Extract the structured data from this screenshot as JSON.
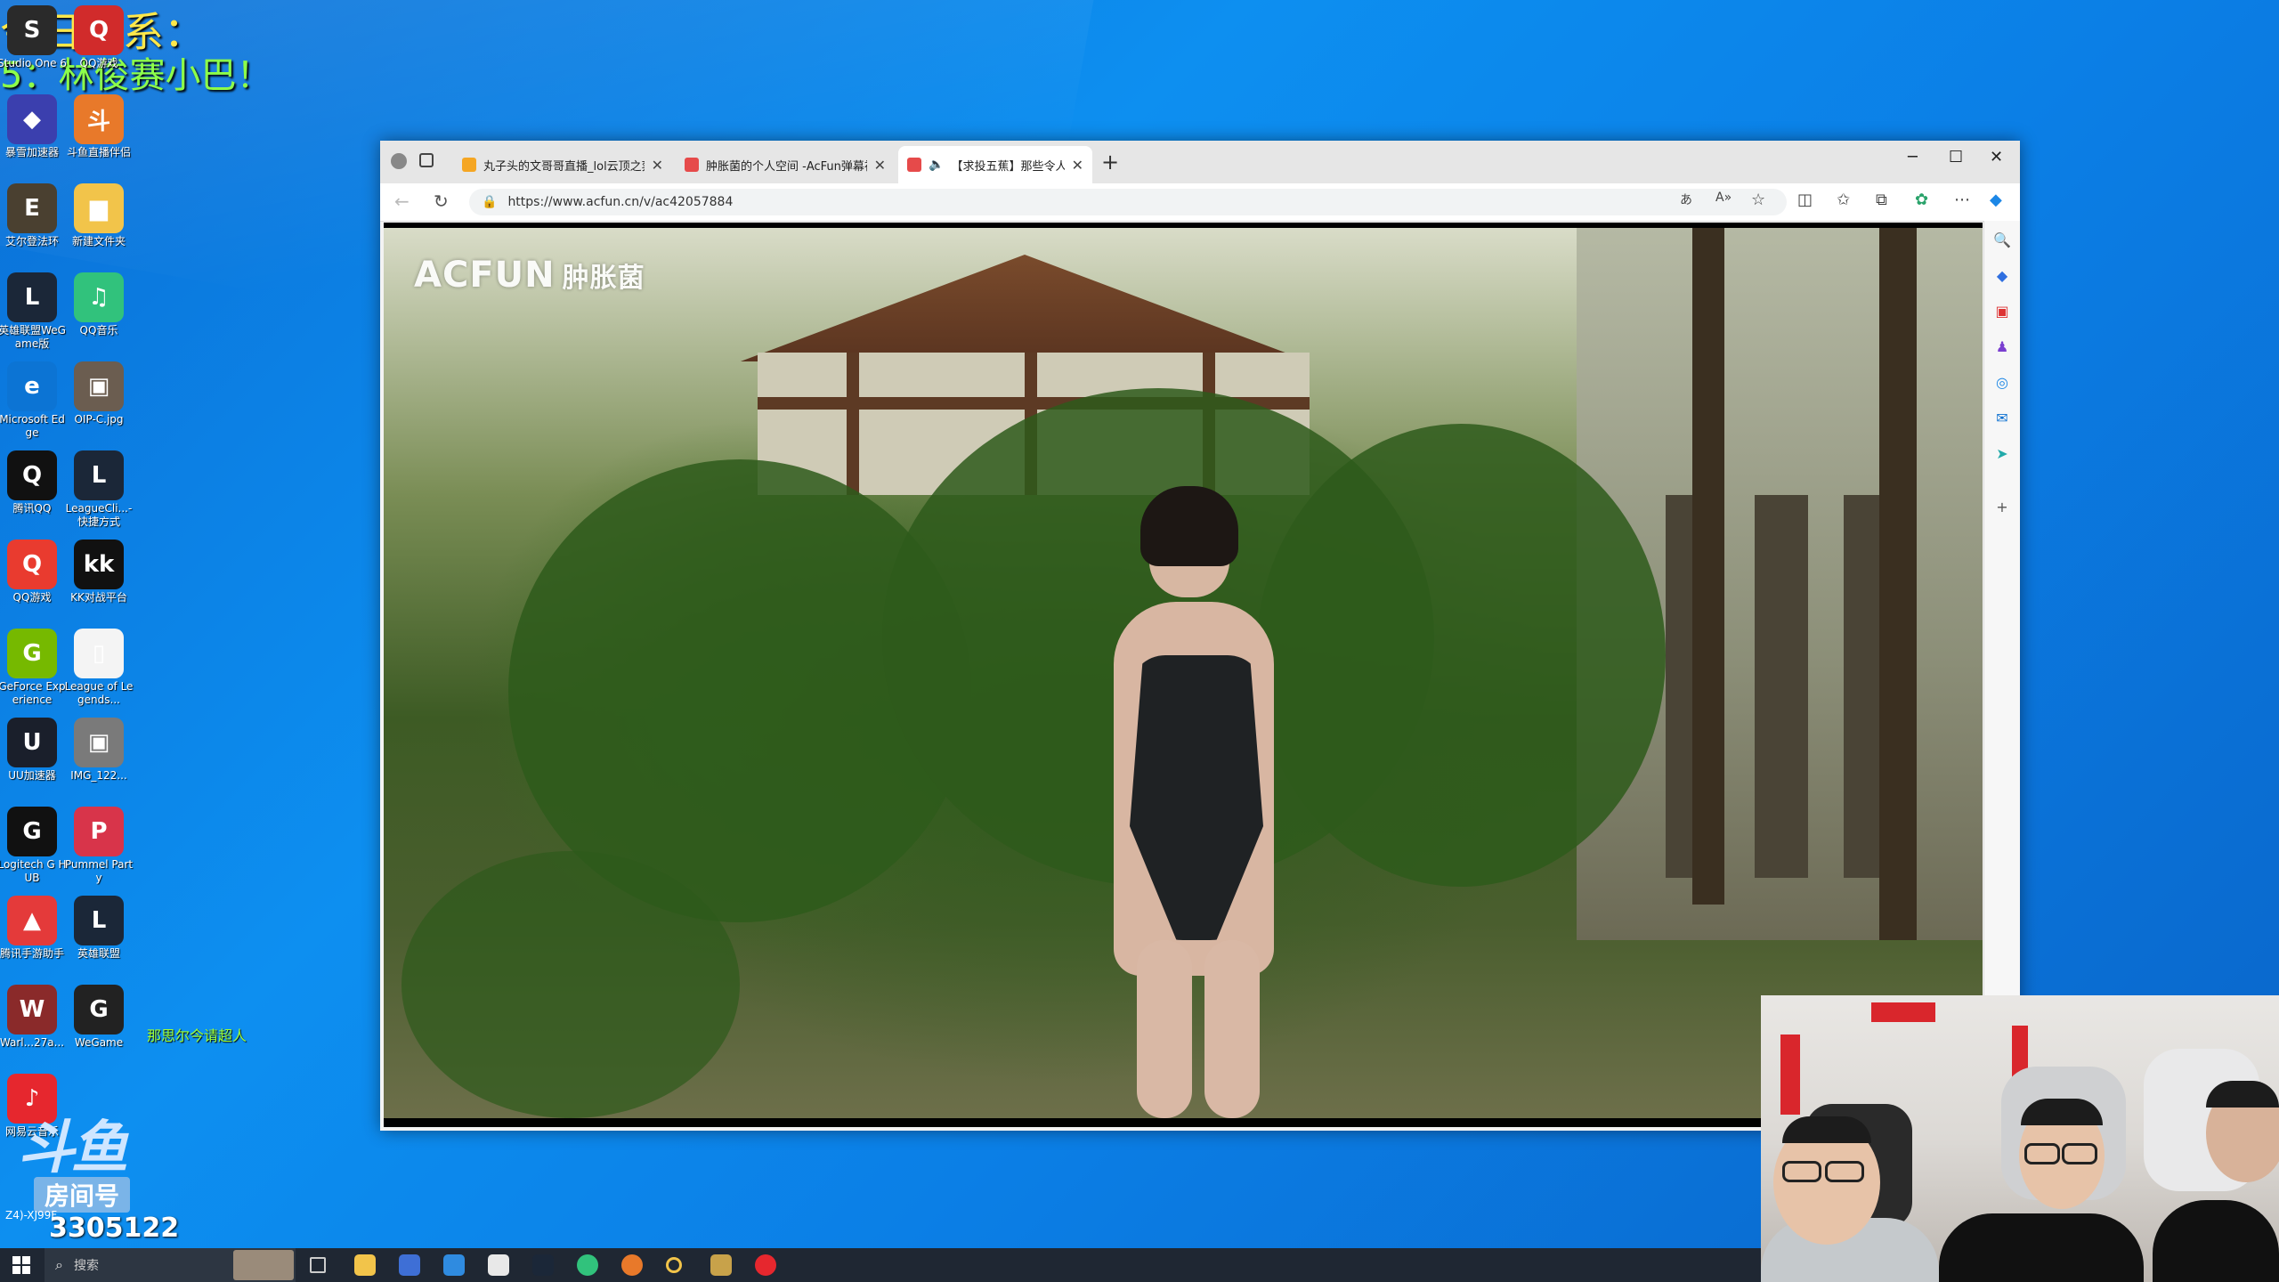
{
  "overlay": {
    "line1": "今日菜系：",
    "line2": "5：林俊赛小巴！"
  },
  "desktop_icons": [
    {
      "label": "Studio One 6",
      "color": "#2a2a2a",
      "glyph": "S"
    },
    {
      "label": "QQ游戏",
      "color": "#d12b2b",
      "glyph": "Q"
    },
    {
      "label": "暴雪加速器",
      "color": "#3b3fae",
      "glyph": "◆"
    },
    {
      "label": "斗鱼直播伴侣",
      "color": "#e8792a",
      "glyph": "斗"
    },
    {
      "label": "艾尔登法环",
      "color": "#4a4030",
      "glyph": "E"
    },
    {
      "label": "新建文件夹",
      "color": "#f2c44a",
      "glyph": "▆"
    },
    {
      "label": "英雄联盟WeGame版",
      "color": "#1b2738",
      "glyph": "L"
    },
    {
      "label": "QQ音乐",
      "color": "#31c27c",
      "glyph": "♫"
    },
    {
      "label": "Microsoft Edge",
      "color": "#0c74d4",
      "glyph": "e"
    },
    {
      "label": "OIP-C.jpg",
      "color": "#6b5d50",
      "glyph": "▣"
    },
    {
      "label": "腾讯QQ",
      "color": "#111111",
      "glyph": "Q"
    },
    {
      "label": "LeagueCli...-快捷方式",
      "color": "#1b2738",
      "glyph": "L"
    },
    {
      "label": "QQ游戏",
      "color": "#e93b2f",
      "glyph": "Q"
    },
    {
      "label": "KK对战平台",
      "color": "#111111",
      "glyph": "kk"
    },
    {
      "label": "GeForce Experience",
      "color": "#76b900",
      "glyph": "G"
    },
    {
      "label": "League of Legends...",
      "color": "#f4f4f4",
      "glyph": "▯"
    },
    {
      "label": "UU加速器",
      "color": "#1a1f2b",
      "glyph": "U"
    },
    {
      "label": "IMG_122...",
      "color": "#7a7a7a",
      "glyph": "▣"
    },
    {
      "label": "Logitech G HUB",
      "color": "#111111",
      "glyph": "G"
    },
    {
      "label": "Pummel Party",
      "color": "#d8344a",
      "glyph": "P"
    },
    {
      "label": "腾讯手游助手",
      "color": "#e43a3a",
      "glyph": "▲"
    },
    {
      "label": "英雄联盟",
      "color": "#1b2738",
      "glyph": "L"
    },
    {
      "label": "Warl...27a...",
      "color": "#8a2a2a",
      "glyph": "W"
    },
    {
      "label": "WeGame",
      "color": "#222222",
      "glyph": "G"
    },
    {
      "label": "网易云音乐",
      "color": "#e6272e",
      "glyph": "♪"
    }
  ],
  "side_note": "那思尔今请超人",
  "brand": {
    "logo": "斗鱼",
    "room_label": "房间号",
    "room_number": "3305122",
    "small_text": "Z4)-XJ99F"
  },
  "browser": {
    "tabs": [
      {
        "title": "丸子头的文哥哥直播_lol云顶之弈",
        "fav_color": "#f5a623"
      },
      {
        "title": "肿胀菌的个人空间 -AcFun弹幕视",
        "fav_color": "#e64a4a"
      },
      {
        "title": "【求投五蕉】那些令人心动",
        "fav_color": "#e64a4a"
      }
    ],
    "new_tab": "+",
    "controls": {
      "minimize": "─",
      "maximize": "☐",
      "close": "✕"
    },
    "nav": {
      "back": "←",
      "refresh": "↻"
    },
    "url": "https://www.acfun.cn/v/ac42057884",
    "video_watermark": "ACFUN",
    "video_watermark_sub": "肿胀菌"
  },
  "taskbar": {
    "search_placeholder": "搜索"
  }
}
